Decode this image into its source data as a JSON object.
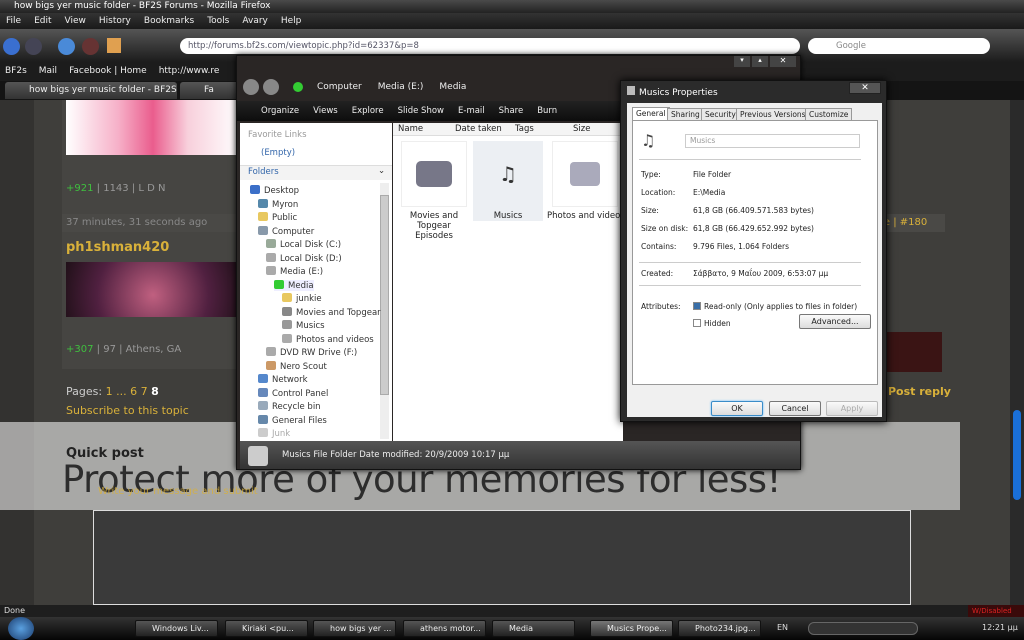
{
  "browser": {
    "title": "how bigs yer music folder - BF2S Forums - Mozilla Firefox",
    "menu": [
      "File",
      "Edit",
      "View",
      "History",
      "Bookmarks",
      "Tools",
      "Avary",
      "Help"
    ],
    "url": "http://forums.bf2s.com/viewtopic.php?id=62337&p=8",
    "search_placeholder": "Google",
    "bookmarks": [
      "BF2s",
      "Mail",
      "Facebook | Home",
      "http://www.re"
    ],
    "tabs": [
      "how bigs yer music folder - BF2S F...",
      "Fa"
    ],
    "status": "Done"
  },
  "forum": {
    "post1_stats": {
      "rep": "+921",
      "rest": "| 1143 | L D N"
    },
    "post2_time": "37 minutes, 31 seconds ago",
    "post2_meta": "te | #180",
    "post2_user": "ph1shman420",
    "post2_stats": {
      "rep": "+307",
      "rest": "| 97 | Athens, GA"
    },
    "pages_label": "Pages:",
    "pages": [
      "1",
      "...",
      "6",
      "7",
      "8"
    ],
    "subscribe": "Subscribe to this topic",
    "post_reply": "Post reply",
    "quick_post": "Quick post",
    "textarea_label": "Write your message and submit"
  },
  "watermark": "Protect more of your memories for less!",
  "explorer": {
    "breadcrumb": [
      "Computer",
      "Media (E:)",
      "Media"
    ],
    "toolbar": [
      "Organize",
      "Views",
      "Explore",
      "Slide Show",
      "E-mail",
      "Share",
      "Burn"
    ],
    "favorite_links": "Favorite Links",
    "empty": "(Empty)",
    "folders": "Folders",
    "tree": [
      "Desktop",
      "Myron",
      "Public",
      "Computer",
      "Local Disk (C:)",
      "Local Disk (D:)",
      "Media (E:)",
      "Media",
      "junkie",
      "Movies and  Topgear",
      "Musics",
      "Photos and videos",
      "DVD RW Drive (F:)",
      "Nero Scout",
      "Network",
      "Control Panel",
      "Recycle bin",
      "General Files",
      "Junk"
    ],
    "columns": [
      "Name",
      "Date taken",
      "Tags",
      "Size"
    ],
    "items": [
      "Movies and Topgear Episodes",
      "Musics",
      "Photos and videos"
    ],
    "status": "Musics File Folder  Date modified: 20/9/2009 10:17 μμ"
  },
  "dialog": {
    "title": "Musics Properties",
    "tabs": [
      "General",
      "Sharing",
      "Security",
      "Previous Versions",
      "Customize"
    ],
    "name": "Musics",
    "fields": [
      {
        "label": "Type:",
        "value": "File Folder"
      },
      {
        "label": "Location:",
        "value": "E:\\Media"
      },
      {
        "label": "Size:",
        "value": "61,8 GB (66.409.571.583 bytes)"
      },
      {
        "label": "Size on disk:",
        "value": "61,8 GB (66.429.652.992 bytes)"
      },
      {
        "label": "Contains:",
        "value": "9.796 Files, 1.064 Folders"
      },
      {
        "label": "Created:",
        "value": "Σάββατο, 9 Μαΐου 2009, 6:53:07 μμ"
      }
    ],
    "attributes_label": "Attributes:",
    "readonly": "Read-only (Only applies to files in folder)",
    "readonly_checked": true,
    "hidden": "Hidden",
    "hidden_checked": false,
    "advanced": "Advanced...",
    "ok": "OK",
    "cancel": "Cancel",
    "apply": "Apply"
  },
  "taskbar": {
    "tasks": [
      "Windows Liv...",
      "Kiriaki   <pu...",
      "how bigs yer ...",
      "athens motor...",
      "Media",
      "Musics Prope...",
      "Photo234.jpg..."
    ],
    "lang": "EN",
    "clock": "12:21 μμ"
  },
  "colors": {
    "accent_gold": "#d9b13a",
    "rep_green": "#3fbf3f"
  }
}
